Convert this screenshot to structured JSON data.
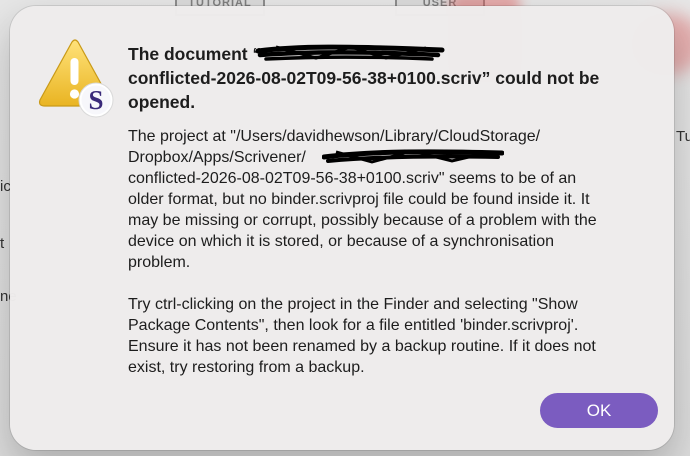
{
  "background": {
    "card_1_label": "TUTORIAL",
    "card_2_label": "USER",
    "edge_right_text": "Tu",
    "edge_left_1": "ic",
    "edge_left_2": "t",
    "edge_left_3": "ne"
  },
  "alert": {
    "title_lines": [
      "The document “",
      "conflicted-2026-08-02T09-56-38+0100.scriv” could not be",
      "opened."
    ],
    "message": {
      "paragraph_1": [
        "The project at \"/Users/davidhewson/Library/CloudStorage/",
        "Dropbox/Apps/Scrivener/",
        "conflicted-2026-08-02T09-56-38+0100.scriv\" seems to be of an",
        "older format, but no binder.scrivproj file could be found inside it. It",
        "may be missing or corrupt, possibly because of a problem with the",
        "device on which it is stored, or because of a synchronisation",
        "problem."
      ],
      "paragraph_2": [
        "Try ctrl-clicking on the project in the Finder and selecting \"Show",
        "Package Contents\", then look for a file entitled 'binder.scrivproj'.",
        "Ensure it has not been renamed by a backup routine. If it does not",
        "exist, try restoring from a backup."
      ]
    },
    "ok_label": "OK",
    "icon": "warning-triangle-icon with scrivener-app-badge",
    "redaction": "black scribble redaction over document name"
  },
  "colors": {
    "button_purple": "#7b5cc0",
    "warning_yellow": "#f3c93a",
    "text": "#1d1d1d",
    "sheet": "#eeecec"
  }
}
